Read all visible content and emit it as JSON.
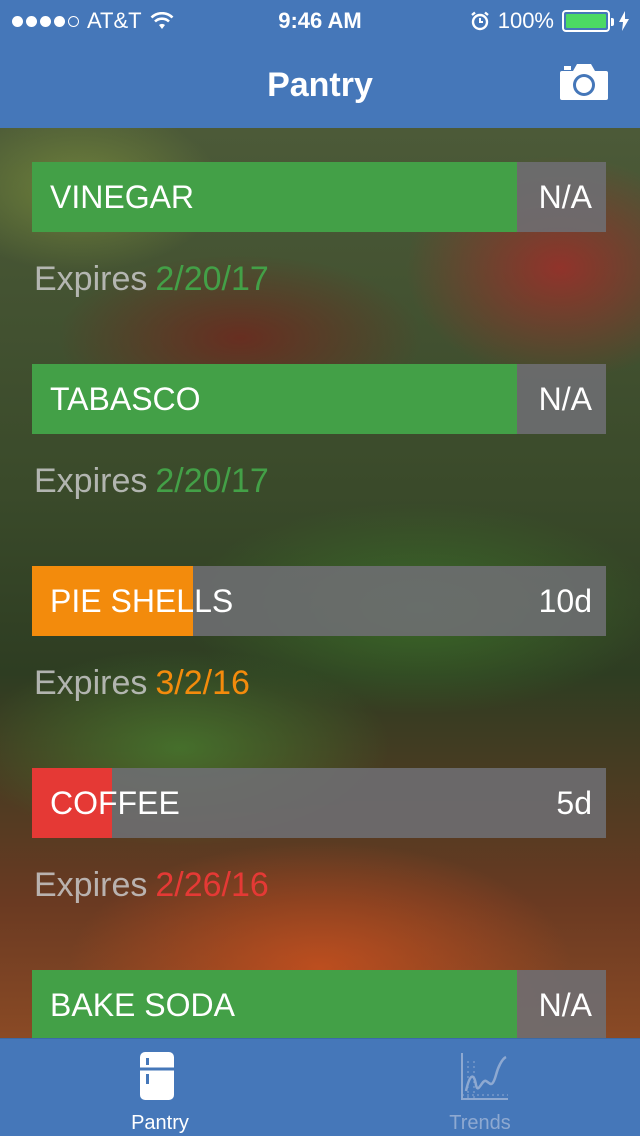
{
  "status_bar": {
    "carrier": "AT&T",
    "time": "9:46 AM",
    "battery": "100%"
  },
  "nav": {
    "title": "Pantry",
    "camera_icon": "camera-icon"
  },
  "expires_label": "Expires",
  "items": [
    {
      "name": "VINEGAR",
      "days": "N/A",
      "expires": "2/20/17",
      "status_color": "#43a047",
      "fill_fraction": 0.845
    },
    {
      "name": "TABASCO",
      "days": "N/A",
      "expires": "2/20/17",
      "status_color": "#43a047",
      "fill_fraction": 0.845
    },
    {
      "name": "PIE SHELLS",
      "days": "10d",
      "expires": "3/2/16",
      "status_color": "#f38b0c",
      "fill_fraction": 0.28
    },
    {
      "name": "COFFEE",
      "days": "5d",
      "expires": "2/26/16",
      "status_color": "#e53935",
      "fill_fraction": 0.14
    },
    {
      "name": "BAKE SODA",
      "days": "N/A",
      "expires": "",
      "status_color": "#43a047",
      "fill_fraction": 0.845
    }
  ],
  "tabs": [
    {
      "label": "Pantry",
      "icon": "fridge-icon",
      "active": true
    },
    {
      "label": "Trends",
      "icon": "chart-icon",
      "active": false
    }
  ],
  "colors": {
    "nav_blue": "#4577b9",
    "active_tab": "#ffffff",
    "inactive_tab": "#8ea9d1"
  }
}
